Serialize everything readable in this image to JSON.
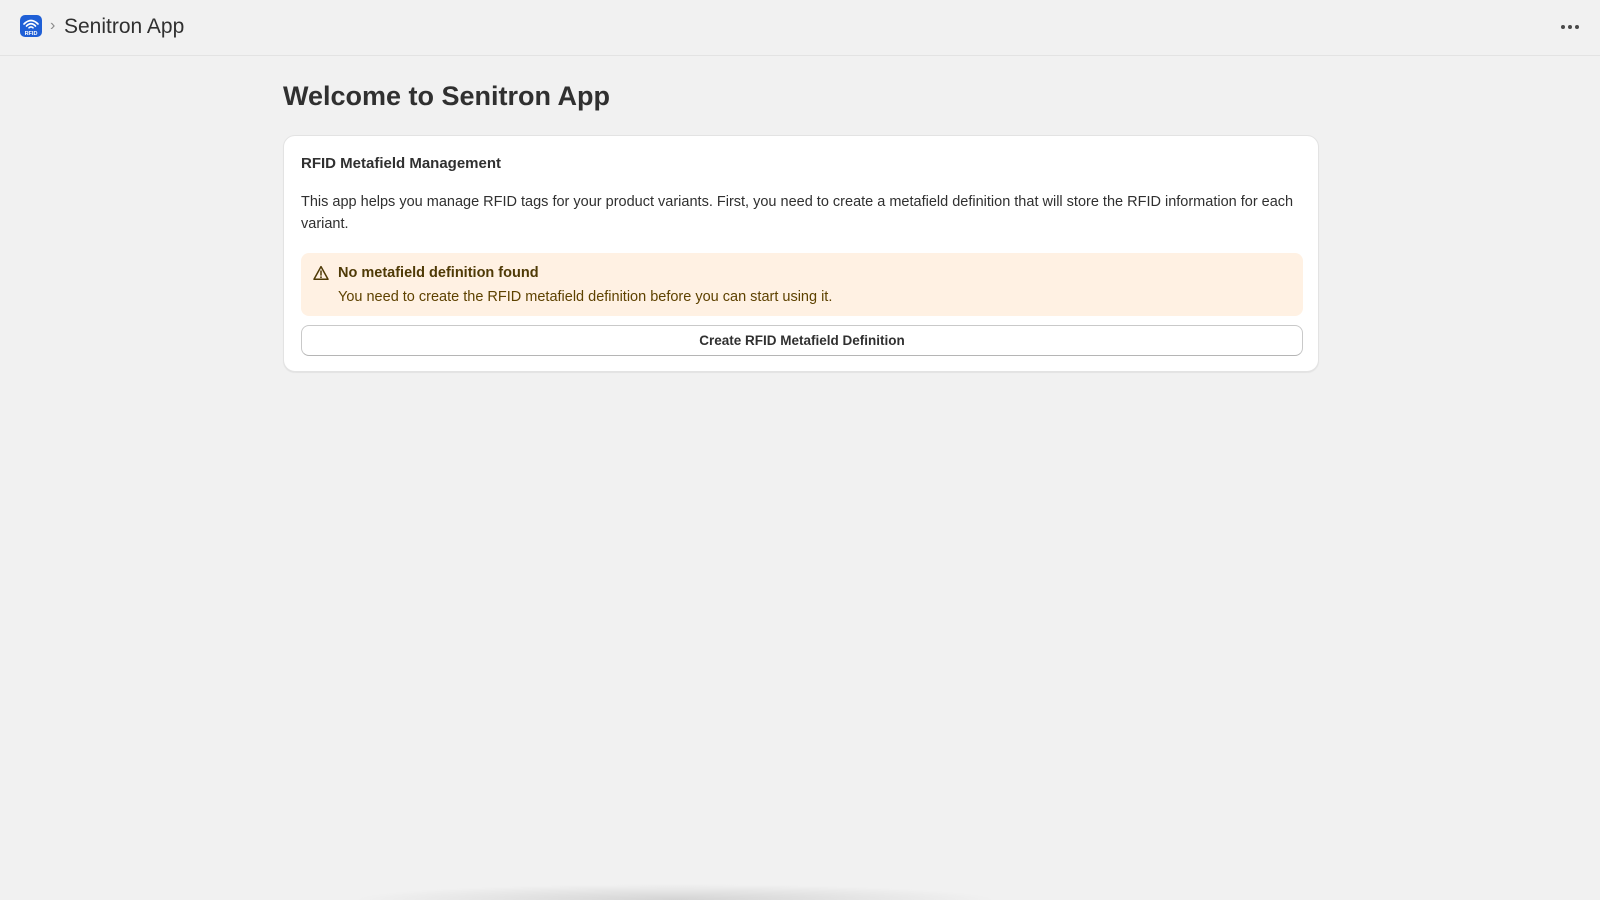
{
  "topbar": {
    "app_icon": "rfid-app-icon",
    "app_icon_text": "RFID",
    "breadcrumb_separator": "›",
    "app_name": "Senitron App",
    "more_icon": "more-horizontal-icon"
  },
  "page": {
    "title": "Welcome to Senitron App"
  },
  "card": {
    "title": "RFID Metafield Management",
    "description": "This app helps you manage RFID tags for your product variants. First, you need to create a metafield definition that will store the RFID information for each variant.",
    "banner": {
      "icon": "warning-icon",
      "title": "No metafield definition found",
      "text": "You need to create the RFID metafield definition before you can start using it.",
      "background_color": "#fff1e3"
    },
    "button_label": "Create RFID Metafield Definition"
  },
  "colors": {
    "app_icon_bg": "#1f5fd6",
    "page_bg": "#f1f1f1"
  }
}
